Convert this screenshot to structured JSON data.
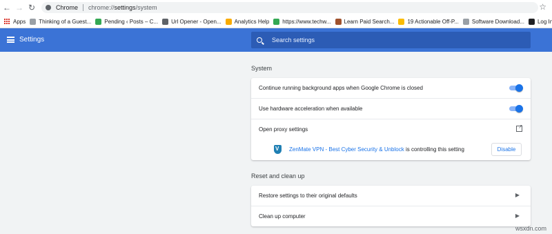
{
  "toolbar": {
    "site_label": "Chrome",
    "url_prefix": "chrome://",
    "url_path": "settings",
    "url_suffix": "/system"
  },
  "bookmarks": [
    {
      "label": "Apps",
      "icon": "apps-grid-icon",
      "color": "#d93025"
    },
    {
      "label": "Thinking of a Guest...",
      "icon": "favicon",
      "color": "#9aa0a6"
    },
    {
      "label": "Pending ‹ Posts – C...",
      "icon": "favicon",
      "color": "#34a853"
    },
    {
      "label": "Url Opener - Open...",
      "icon": "favicon",
      "color": "#5f6368"
    },
    {
      "label": "Analytics Help",
      "icon": "favicon",
      "color": "#f9ab00"
    },
    {
      "label": "https://www.techw...",
      "icon": "favicon",
      "color": "#34a853"
    },
    {
      "label": "Learn Paid Search...",
      "icon": "favicon",
      "color": "#a0522d"
    },
    {
      "label": "19 Actionable Off-P...",
      "icon": "favicon",
      "color": "#fbbc04"
    },
    {
      "label": "Software Download...",
      "icon": "favicon",
      "color": "#9aa0a6"
    },
    {
      "label": "Log In ‹ Te",
      "icon": "favicon",
      "color": "#202124"
    }
  ],
  "header": {
    "title": "Settings",
    "search_placeholder": "Search settings"
  },
  "system": {
    "title": "System",
    "background_apps_label": "Continue running background apps when Google Chrome is closed",
    "hardware_accel_label": "Use hardware acceleration when available",
    "proxy_label": "Open proxy settings",
    "extension_link": "ZenMate VPN - Best Cyber Security & Unblock",
    "extension_suffix": " is controlling this setting",
    "disable_label": "Disable"
  },
  "reset": {
    "title": "Reset and clean up",
    "restore_label": "Restore settings to their original defaults",
    "cleanup_label": "Clean up computer"
  },
  "watermark": "wsxdn.com",
  "colors": {
    "header_bg": "#3b73d6",
    "accent": "#1a73e8"
  }
}
